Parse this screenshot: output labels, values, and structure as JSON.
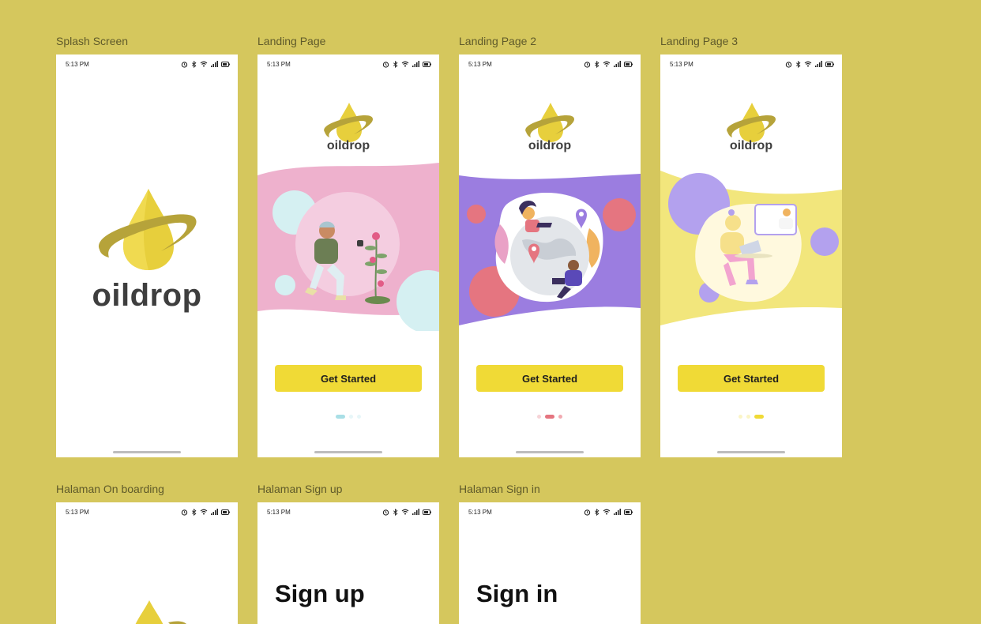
{
  "frames": [
    {
      "label": "Splash Screen"
    },
    {
      "label": "Landing Page"
    },
    {
      "label": "Landing Page 2"
    },
    {
      "label": "Landing Page 3"
    },
    {
      "label": "Halaman On boarding"
    },
    {
      "label": "Halaman Sign up"
    },
    {
      "label": "Halaman Sign in"
    }
  ],
  "status_bar": {
    "time": "5:13 PM",
    "icons": [
      "alarm-icon",
      "bluetooth-icon",
      "wifi-icon",
      "signal-icon",
      "battery-icon"
    ]
  },
  "brand": {
    "name": "oildrop",
    "logo_color": "#e7cf3c",
    "ring_color": "#b6a33a"
  },
  "landing": {
    "cta_label": "Get Started",
    "pages": [
      {
        "bg": "#eeb1cd",
        "dot_color": "#a9dfe6",
        "active_dot": 0
      },
      {
        "bg": "#9b7de0",
        "dot_color": "#e57580",
        "active_dot": 1
      },
      {
        "bg": "#f2e67c",
        "dot_color": "#f0da36",
        "active_dot": 2
      }
    ]
  },
  "signup": {
    "title": "Sign up"
  },
  "signin": {
    "title": "Sign in"
  },
  "colors": {
    "canvas": "#d5c75d",
    "accent": "#f0da36",
    "text_dark": "#3e3e3e"
  }
}
